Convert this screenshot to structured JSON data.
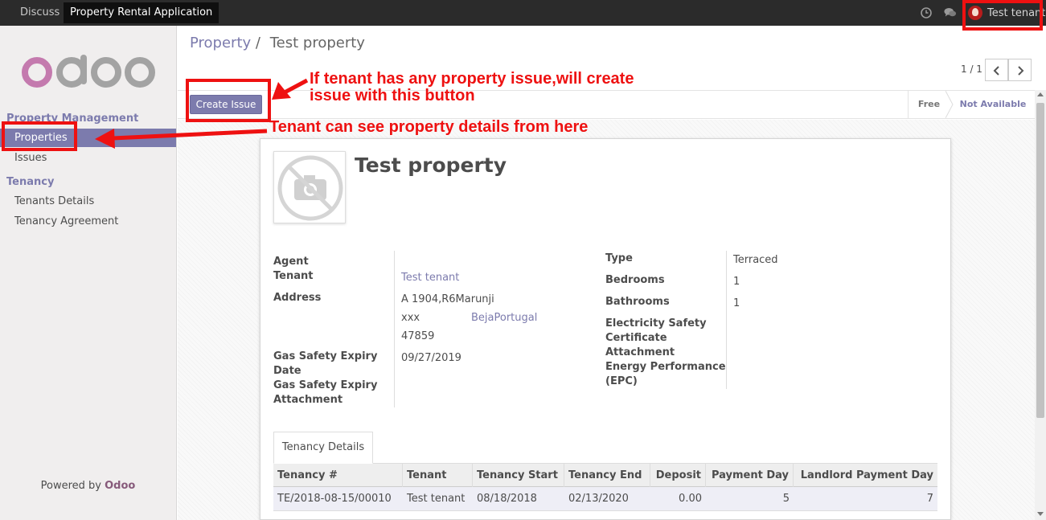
{
  "navbar": {
    "discuss": "Discuss",
    "app": "Property Rental Application",
    "user": "Test tenant",
    "clock_icon": "clock-icon",
    "chat_icon": "chat-icon"
  },
  "sidebar": {
    "logo": "odoo",
    "sections": [
      {
        "header": "Property Management",
        "items": [
          "Properties",
          "Issues"
        ]
      },
      {
        "header": "Tenancy",
        "items": [
          "Tenants Details",
          "Tenancy Agreement"
        ]
      }
    ],
    "powered_prefix": "Powered by",
    "powered_brand": "Odoo"
  },
  "breadcrumb": {
    "parent": "Property",
    "separator": "/",
    "current": "Test property"
  },
  "pager": {
    "value": "1 / 1"
  },
  "statusbar": {
    "create_issue": "Create Issue",
    "stages": [
      "Free",
      "Not Available"
    ],
    "active_stage": "Not Available"
  },
  "record": {
    "title": "Test property",
    "left_labels": {
      "agent": "Agent",
      "tenant": "Tenant",
      "address": "Address",
      "gas_date_1": "Gas Safety Expiry",
      "gas_date_2": "Date",
      "gas_att_1": "Gas Safety Expiry",
      "gas_att_2": "Attachment"
    },
    "left_values": {
      "tenant": "Test tenant",
      "street": "A 1904,R6Marunji",
      "city": "xxx",
      "state_country": "BejaPortugal",
      "zip": "47859",
      "gas_date": "09/27/2019"
    },
    "right_labels": {
      "type": "Type",
      "bedrooms": "Bedrooms",
      "bathrooms": "Bathrooms",
      "elec_1": "Electricity Safety",
      "elec_2": "Certificate",
      "elec_3": "Attachment",
      "epc_1": "Energy Performance",
      "epc_2": "(EPC)"
    },
    "right_values": {
      "type": "Terraced",
      "bedrooms": "1",
      "bathrooms": "1"
    }
  },
  "tabs": {
    "tenancy_details": "Tenancy Details"
  },
  "table": {
    "headers": [
      "Tenancy #",
      "Tenant",
      "Tenancy Start",
      "Tenancy End",
      "Deposit",
      "Payment Day",
      "Landlord Payment Day"
    ],
    "rows": [
      [
        "TE/2018-08-15/00010",
        "Test tenant",
        "08/18/2018",
        "02/13/2020",
        "0.00",
        "5",
        "7"
      ]
    ]
  },
  "annotations": {
    "issue_note_1": "If tenant has any property issue,will create",
    "issue_note_2": "issue with this button",
    "properties_note": "Tenant can see property details from here",
    "color": "#ee1111"
  },
  "colors": {
    "accent": "#7c7bad",
    "brand": "#875a7b",
    "navbar": "#2b2b2b"
  }
}
